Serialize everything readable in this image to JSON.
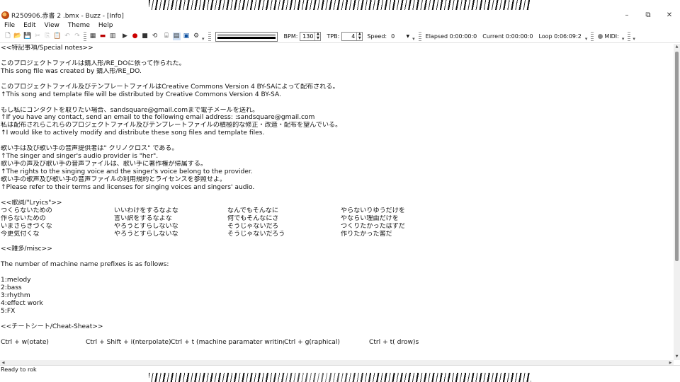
{
  "window": {
    "title": "R250906.赤書 2 .bmx - Buzz - [Info]",
    "controls": {
      "minimize": "–",
      "maximize": "⧉",
      "close": "✕"
    }
  },
  "menu": [
    "File",
    "Edit",
    "View",
    "Theme",
    "Help"
  ],
  "toolbar": {
    "bpm_label": "BPM:",
    "bpm_value": "130",
    "tpb_label": "TPB:",
    "tpb_value": "4",
    "speed_label": "Speed:",
    "speed_value": "0",
    "elapsed": "Elapsed 0:00:00:0",
    "current": "Current 0:00:00:0",
    "loop": "Loop 0:06:09:2",
    "midi_label": "MIDI:",
    "icons": [
      "new-file-icon",
      "open-file-icon",
      "save-icon",
      "cut-icon",
      "copy-icon",
      "paste-icon",
      "undo-icon",
      "redo-icon",
      "machines-view-icon",
      "patterns-view-icon",
      "sequence-view-icon",
      "play-icon",
      "record-icon",
      "stop-icon",
      "loop-icon",
      "wavetable-icon",
      "song-info-icon",
      "analyzer-icon",
      "settings-icon"
    ]
  },
  "content": {
    "lines": [
      "<<特記事項/Special notes>>",
      "",
      "このプロジェクトファイルは錆人形/RE_DOに依って作られた。",
      "This song file was created by 錆人形/RE_DO.",
      "",
      "このプロジェクトファイル及びテンプレートファイルはCreative Commons Version 4 BY-SAによって配布される。",
      "↑This song and template file will be distributed by Creative Commons Version 4 BY-SA.",
      "",
      "もし私にコンタクトを取りたい場合、sandsquare@gmail.comまで電子メールを送れ。",
      "↑If you have any contact, send an email to the following email address: :sandsquare@gmail.com",
      "私は配布されらこれらのプロジェクトファイル及びテンプレートファイルの積極的な修正・改造・配布を望んでいる。",
      "↑I would like to actively modify and distribute these song files and template files.",
      "",
      "歌い手は及び歌い手の音声提供者は\" クリノクロス\" である。",
      "↑The singer and singer's audio provider is \"her\".",
      "歌い手の声及び歌い手の音声ファイルは、歌い手に著作権が帰属する。",
      "↑The rights to the singing voice and the singer's voice belong to the provider.",
      "歌い手の歌声及び歌い手の音声ファイルの利用規約とライセンスを参照せよ。",
      "↑Please refer to their terms and licenses for singing voices and singers' audio.",
      "",
      "<<歌詞/\"Lryics\">>"
    ],
    "lyrics": [
      [
        "つくらないための",
        "いいわけをするなよな",
        "なんでもそんなに",
        "やらないりゆうだけを"
      ],
      [
        "作らないための",
        "言い訳をするなよな",
        "何でもそんなにさ",
        "やならい理由だけを"
      ],
      [
        "いまさらきづくな",
        "やろうとすらしないな",
        "そうじゃないだろ",
        "つくりたかったはずだ"
      ],
      [
        "今更気付くな",
        "やろうとすらしないな",
        "そうじゃないだろう",
        "作りたかった筈だ"
      ]
    ],
    "lines_after": [
      "",
      "<<雑多/misc>>",
      "",
      "The number of machine name prefixes is as follows:",
      "",
      "1:melody",
      "2:bass",
      "3:rhythm",
      "4:effect work",
      "5:FX",
      "",
      "<<チートシート/Cheat-Sheat>>",
      ""
    ],
    "cheat": [
      "Ctrl + w(otate)",
      "Ctrl + Shift + i(nterpolate)",
      "Ctrl + t (machine paramater writing)",
      "Ctrl + g(raphical)",
      "Ctrl + t( drow)s"
    ]
  },
  "status": "Ready to rok"
}
